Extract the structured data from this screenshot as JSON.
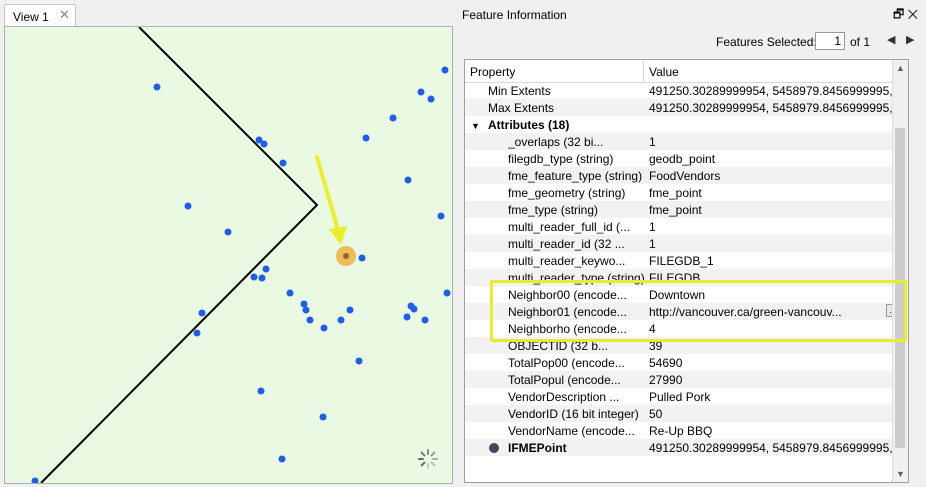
{
  "view_tab": {
    "label": "View 1",
    "close_glyph": "✕"
  },
  "map": {
    "background_color": "#eaf9e1",
    "point_color": "#1e5eea",
    "selected_point_color": "#f0b548",
    "arrow_color": "#e8f02a",
    "busy_indicator": "spinner-icon"
  },
  "panel": {
    "title": "Feature Information",
    "float_glyph": "🗗",
    "close_glyph": "✕",
    "features_selected_label": "Features Selected:",
    "selected_index": "1",
    "of_label": "of 1",
    "prev_glyph": "◀",
    "next_glyph": "▶"
  },
  "table": {
    "col_property": "Property",
    "col_value": "Value",
    "ellipsis_button": "...",
    "rows": [
      {
        "property": "Min Extents",
        "value": "491250.30289999954, 5458979.8456999995, 0"
      },
      {
        "property": "Max Extents",
        "value": "491250.30289999954, 5458979.8456999995, 0"
      },
      {
        "property": "Attributes (18)",
        "value": ""
      },
      {
        "property": "_overlaps (32 bi...",
        "value": "1"
      },
      {
        "property": "filegdb_type (string)",
        "value": "geodb_point"
      },
      {
        "property": "fme_feature_type (string)",
        "value": "FoodVendors"
      },
      {
        "property": "fme_geometry (string)",
        "value": "fme_point"
      },
      {
        "property": "fme_type (string)",
        "value": "fme_point"
      },
      {
        "property": "multi_reader_full_id (...",
        "value": "1"
      },
      {
        "property": "multi_reader_id (32 ...",
        "value": "1"
      },
      {
        "property": "multi_reader_keywo...",
        "value": "FILEGDB_1"
      },
      {
        "property": "multi_reader_type (string)",
        "value": "FILEGDB"
      },
      {
        "property": "Neighbor00 (encode...",
        "value": "Downtown"
      },
      {
        "property": "Neighbor01 (encode...",
        "value": "http://vancouver.ca/green-vancouv..."
      },
      {
        "property": "Neighborho (encode...",
        "value": "4"
      },
      {
        "property": "OBJECTID (32 b...",
        "value": "39"
      },
      {
        "property": "TotalPop00 (encode...",
        "value": "54690"
      },
      {
        "property": "TotalPopul (encode...",
        "value": "27990"
      },
      {
        "property": "VendorDescription ...",
        "value": "Pulled Pork"
      },
      {
        "property": "VendorID (16 bit integer)",
        "value": "50"
      },
      {
        "property": "VendorName (encode...",
        "value": "Re-Up BBQ"
      },
      {
        "property": "IFMEPoint",
        "value": "491250.30289999954, 5458979.8456999995, 0"
      }
    ]
  },
  "highlight_color": "#e3ef2a"
}
